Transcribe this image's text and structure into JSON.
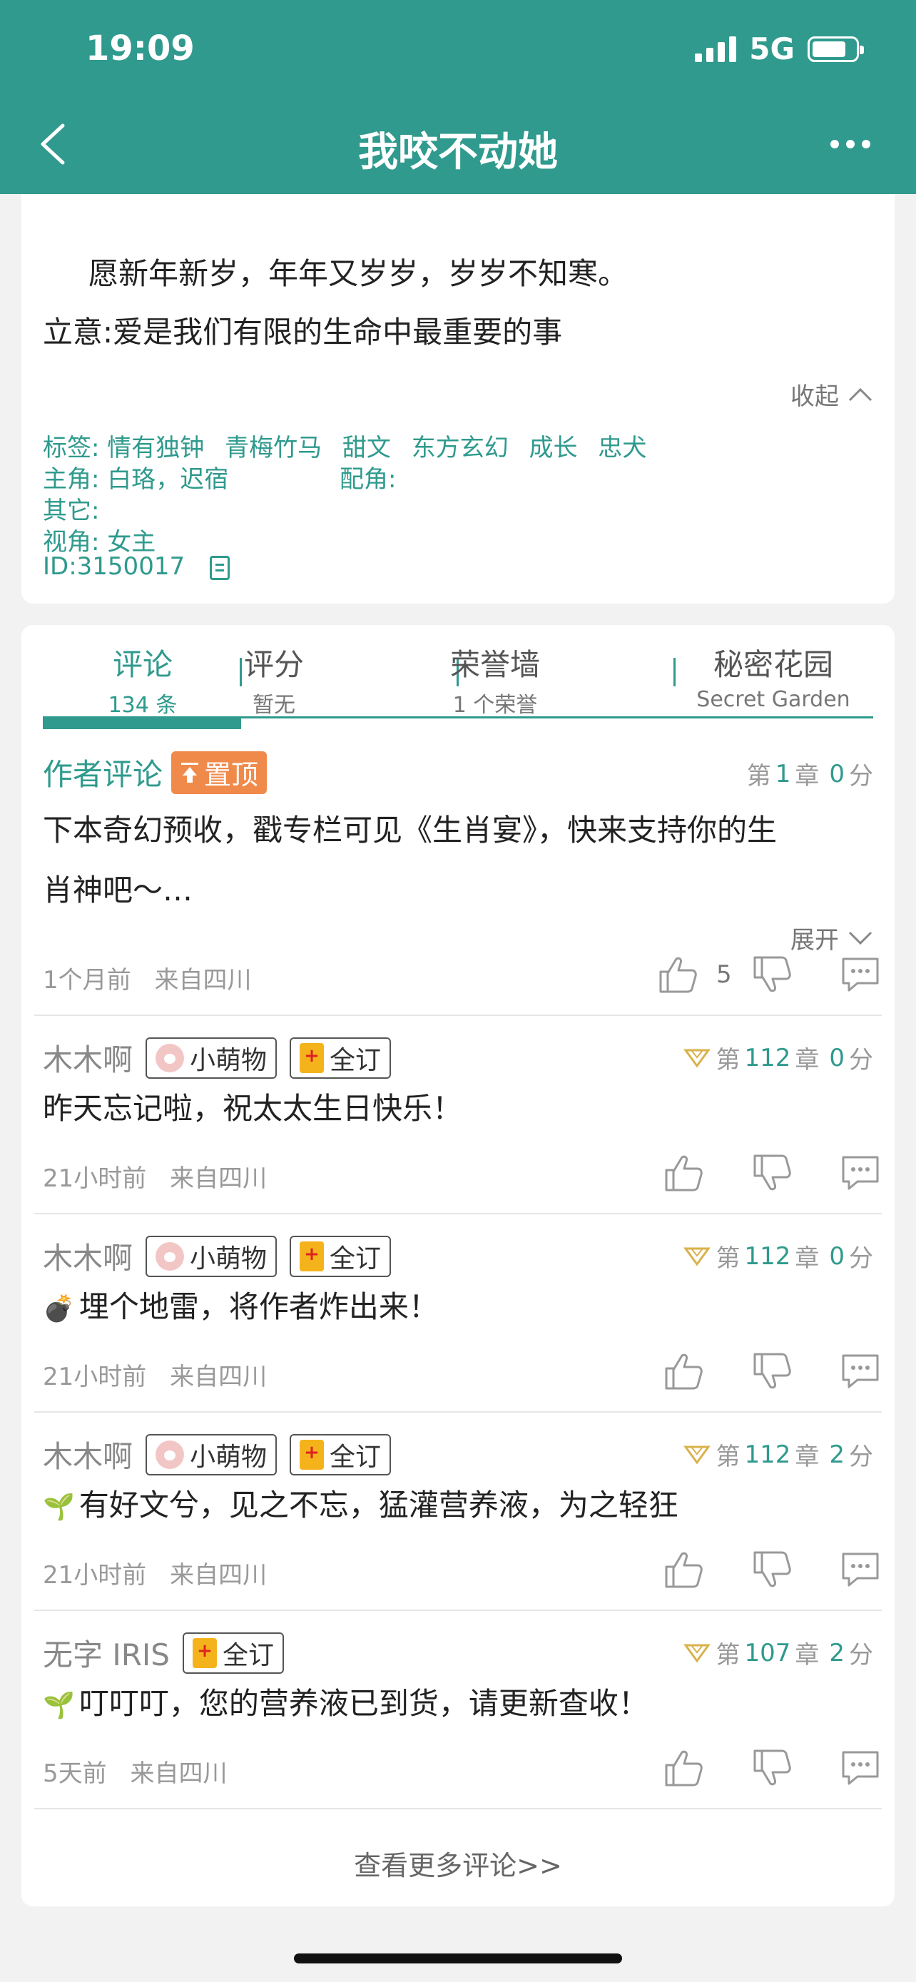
{
  "status": {
    "time": "19:09",
    "network": "5G"
  },
  "nav": {
    "title": "我咬不动她",
    "back_icon": "chevron-left-icon",
    "more_icon": "more-dots-icon"
  },
  "info": {
    "line1": "愿新年新岁，年年又岁岁，岁岁不知寒。",
    "line2": "立意:爱是我们有限的生命中最重要的事",
    "collapse": "收起",
    "tags_label": "标签:",
    "tags": [
      "情有独钟",
      "青梅竹马",
      "甜文",
      "东方玄幻",
      "成长",
      "忠犬"
    ],
    "protagonist_label": "主角:",
    "protagonist": "白珞，迟宿",
    "supporting_label": "配角:",
    "others_label": "其它:",
    "pov_label": "视角:",
    "pov": "女主",
    "id": "ID:3150017"
  },
  "tabs": [
    {
      "label": "评论",
      "sub": "134 条"
    },
    {
      "label": "评分",
      "sub": "暂无"
    },
    {
      "label": "荣誉墙",
      "sub": "1 个荣誉"
    },
    {
      "label": "秘密花园",
      "sub": "Secret Garden"
    }
  ],
  "author_comment": {
    "title": "作者评论",
    "pin": "置顶",
    "chapter_prefix": "第",
    "chapter": "1",
    "chapter_suffix": "章",
    "score": "0",
    "score_suffix": "分",
    "body_line1": "下本奇幻预收，戳专栏可见《生肖宴》，快来支持你的生",
    "body_line2": "肖神吧～…",
    "expand": "展开",
    "time": "1个月前",
    "location": "来自四川",
    "likes": "5"
  },
  "comments": [
    {
      "author": "木木啊",
      "badge1": "小萌物",
      "badge2": "全订",
      "chapter": "112",
      "score": "0",
      "body": "昨天忘记啦，祝太太生日快乐！",
      "time": "21小时前",
      "location": "来自四川"
    },
    {
      "author": "木木啊",
      "badge1": "小萌物",
      "badge2": "全订",
      "chapter": "112",
      "score": "0",
      "body": "埋个地雷，将作者炸出来！",
      "time": "21小时前",
      "location": "来自四川"
    },
    {
      "author": "木木啊",
      "badge1": "小萌物",
      "badge2": "全订",
      "chapter": "112",
      "score": "2",
      "body": "有好文兮，见之不忘，猛灌营养液，为之轻狂",
      "time": "21小时前",
      "location": "来自四川"
    },
    {
      "author": "无字 IRIS",
      "badge2": "全订",
      "chapter": "107",
      "score": "2",
      "body": "叮叮叮，您的营养液已到货，请更新查收！",
      "time": "5天前",
      "location": "来自四川"
    }
  ],
  "chapter_prefix": "第",
  "chapter_suffix": "章",
  "score_suffix": "分",
  "more_comments": "查看更多评论>>",
  "colors": {
    "accent": "#2f9a8d",
    "pin": "#f08a4b",
    "badge_gold": "#f5b31b"
  }
}
